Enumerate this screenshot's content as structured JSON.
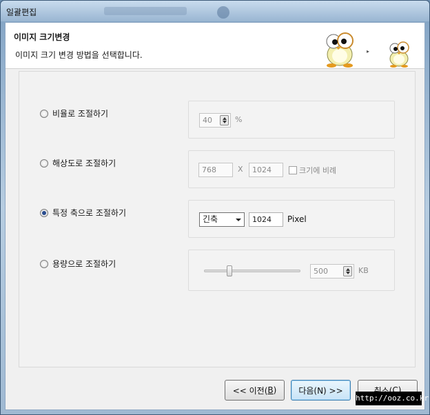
{
  "window": {
    "title": "일괄편집"
  },
  "header": {
    "title": "이미지 크기변경",
    "subtitle": "이미지 크기 변경 방법을 선택합니다.",
    "arrow_glyph": "▸"
  },
  "options": {
    "ratio": {
      "label": "비율로 조절하기",
      "selected": false,
      "value": "40",
      "unit": "%"
    },
    "resolution": {
      "label": "해상도로 조절하기",
      "selected": false,
      "width": "768",
      "times": "X",
      "height": "1024",
      "keep_ratio_label": "크기에 비례"
    },
    "long_side": {
      "label": "특정 축으로 조절하기",
      "selected": true,
      "axis_value": "긴축",
      "size": "1024",
      "unit": "Pixel"
    },
    "filesize": {
      "label": "용량으로 조절하기",
      "selected": false,
      "value": "500",
      "unit": "KB",
      "slider_fraction": 0.25
    }
  },
  "buttons": {
    "prev_pre": "<< 이전(",
    "prev_key": "B",
    "prev_post": ")",
    "next": "다음(N) >>",
    "cancel_pre": "취소(",
    "cancel_key": "C",
    "cancel_post": ")"
  },
  "watermark": "http://ooz.co.kr",
  "colors": {
    "accent": "#3c7fb1",
    "titlebar": "#9ab6d2"
  }
}
